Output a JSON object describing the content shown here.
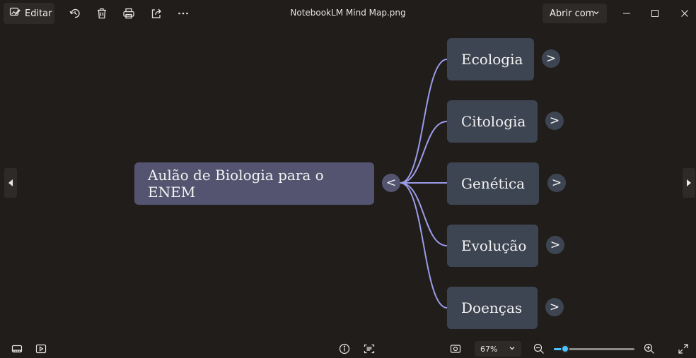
{
  "toolbar": {
    "edit_label": "Editar",
    "icons": [
      "edit-image-icon",
      "rotate-icon",
      "delete-icon",
      "print-icon",
      "share-icon",
      "more-icon"
    ]
  },
  "window": {
    "title": "NotebookLM Mind Map.png",
    "open_with_label": "Abrir com"
  },
  "mindmap": {
    "root": {
      "label": "Aulão de Biologia para o ENEM",
      "toggle": "<"
    },
    "children": [
      {
        "label": "Ecologia",
        "toggle": ">"
      },
      {
        "label": "Citologia",
        "toggle": ">"
      },
      {
        "label": "Genética",
        "toggle": ">"
      },
      {
        "label": "Evolução",
        "toggle": ">"
      },
      {
        "label": "Doenças",
        "toggle": ">"
      }
    ],
    "colors": {
      "root": "#545470",
      "child": "#3e4552",
      "connector": "#9b9be8",
      "background": "#201d1a"
    }
  },
  "bottombar": {
    "zoom_label": "67%",
    "zoom_fraction": 0.14,
    "accent": "#4cc2ff"
  }
}
